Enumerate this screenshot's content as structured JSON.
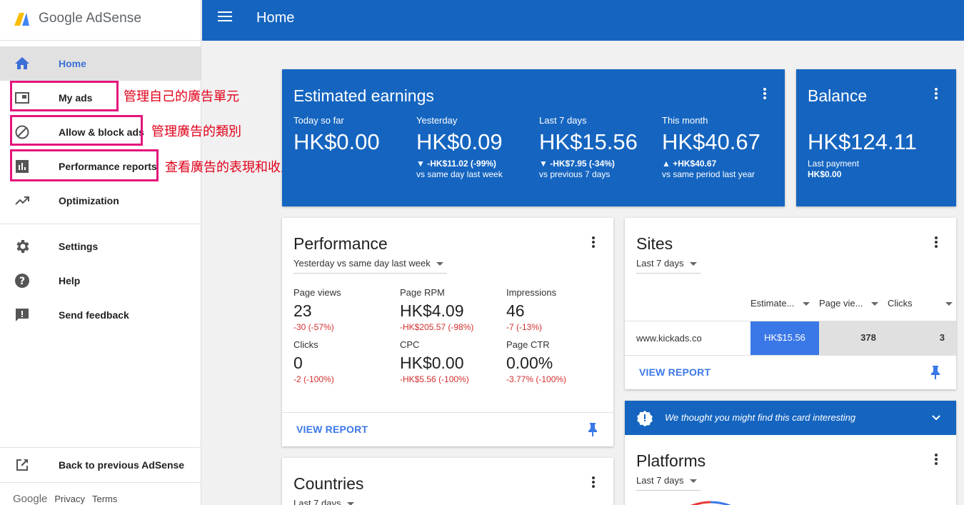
{
  "app": {
    "name": "Google AdSense"
  },
  "sidebar": {
    "items": [
      {
        "label": "Home",
        "icon": "home-icon"
      },
      {
        "label": "My ads",
        "icon": "ad-unit-icon"
      },
      {
        "label": "Allow & block ads",
        "icon": "block-icon"
      },
      {
        "label": "Performance reports",
        "icon": "bar-chart-icon"
      },
      {
        "label": "Optimization",
        "icon": "trending-up-icon"
      },
      {
        "label": "Settings",
        "icon": "gear-icon"
      },
      {
        "label": "Help",
        "icon": "help-icon"
      },
      {
        "label": "Send feedback",
        "icon": "feedback-icon"
      },
      {
        "label": "Back to previous AdSense",
        "icon": "external-link-icon"
      }
    ],
    "footer": {
      "brand": "Google",
      "privacy": "Privacy",
      "terms": "Terms"
    }
  },
  "annotations": {
    "my_ads": "管理自己的廣告單元",
    "allow_block": "管理廣告的類別",
    "performance": "查看廣告的表現和收入"
  },
  "topbar": {
    "title": "Home"
  },
  "earnings": {
    "title": "Estimated earnings",
    "stats": [
      {
        "label": "Today so far",
        "value": "HK$0.00",
        "change": "",
        "compare": ""
      },
      {
        "label": "Yesterday",
        "value": "HK$0.09",
        "change": "▼ -HK$11.02 (-99%)",
        "compare": "vs same day last week"
      },
      {
        "label": "Last 7 days",
        "value": "HK$15.56",
        "change": "▼ -HK$7.95 (-34%)",
        "compare": "vs previous 7 days"
      },
      {
        "label": "This month",
        "value": "HK$40.67",
        "change": "▲ +HK$40.67",
        "compare": "vs same period last year"
      }
    ]
  },
  "balance": {
    "title": "Balance",
    "value": "HK$124.11",
    "last_payment_label": "Last payment",
    "last_payment_value": "HK$0.00"
  },
  "performance": {
    "title": "Performance",
    "period": "Yesterday vs same day last week",
    "metrics": [
      {
        "label": "Page views",
        "value": "23",
        "change": "-30 (-57%)"
      },
      {
        "label": "Page RPM",
        "value": "HK$4.09",
        "change": "-HK$205.57 (-98%)"
      },
      {
        "label": "Impressions",
        "value": "46",
        "change": "-7 (-13%)"
      },
      {
        "label": "Clicks",
        "value": "0",
        "change": "-2 (-100%)"
      },
      {
        "label": "CPC",
        "value": "HK$0.00",
        "change": "-HK$5.56 (-100%)"
      },
      {
        "label": "Page CTR",
        "value": "0.00%",
        "change": "-3.77% (-100%)"
      }
    ],
    "view_report": "VIEW REPORT"
  },
  "sites": {
    "title": "Sites",
    "period": "Last 7 days",
    "columns": [
      "Estimate...",
      "Page vie...",
      "Clicks"
    ],
    "rows": [
      {
        "site": "www.kickads.co",
        "earnings": "HK$15.56",
        "page_views": "378",
        "clicks": "3"
      }
    ],
    "view_report": "VIEW REPORT"
  },
  "suggestion": {
    "text": "We thought you might find this card interesting"
  },
  "platforms": {
    "title": "Platforms",
    "period": "Last 7 days"
  },
  "countries": {
    "title": "Countries",
    "period": "Last 7 days"
  },
  "colors": {
    "brand_blue": "#1565c0",
    "accent_blue": "#3b78e7",
    "negative": "#d32f2f",
    "highlight": "#e4157c"
  }
}
